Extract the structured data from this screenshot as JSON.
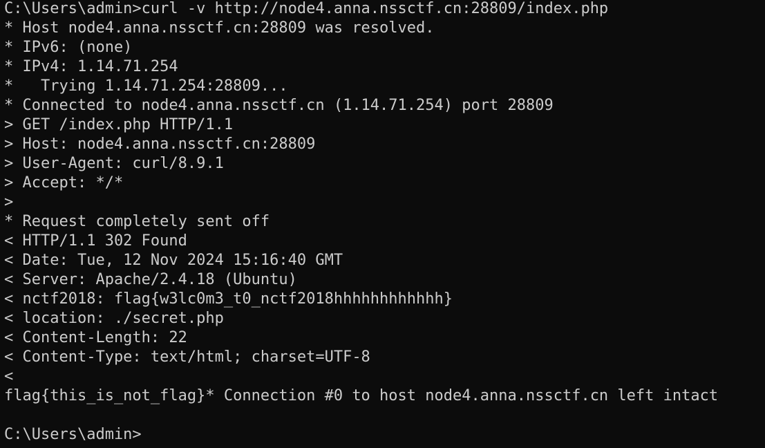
{
  "terminal": {
    "lines": [
      "C:\\Users\\admin>curl -v http://node4.anna.nssctf.cn:28809/index.php",
      "* Host node4.anna.nssctf.cn:28809 was resolved.",
      "* IPv6: (none)",
      "* IPv4: 1.14.71.254",
      "*   Trying 1.14.71.254:28809...",
      "* Connected to node4.anna.nssctf.cn (1.14.71.254) port 28809",
      "> GET /index.php HTTP/1.1",
      "> Host: node4.anna.nssctf.cn:28809",
      "> User-Agent: curl/8.9.1",
      "> Accept: */*",
      ">",
      "* Request completely sent off",
      "< HTTP/1.1 302 Found",
      "< Date: Tue, 12 Nov 2024 15:16:40 GMT",
      "< Server: Apache/2.4.18 (Ubuntu)",
      "< nctf2018: flag{w3lc0m3_t0_nctf2018hhhhhhhhhhhh}",
      "< location: ./secret.php",
      "< Content-Length: 22",
      "< Content-Type: text/html; charset=UTF-8",
      "<",
      "flag{this_is_not_flag}* Connection #0 to host node4.anna.nssctf.cn left intact",
      "",
      "C:\\Users\\admin>"
    ]
  },
  "colors": {
    "background": "#0c0c0c",
    "foreground": "#cccccc"
  }
}
